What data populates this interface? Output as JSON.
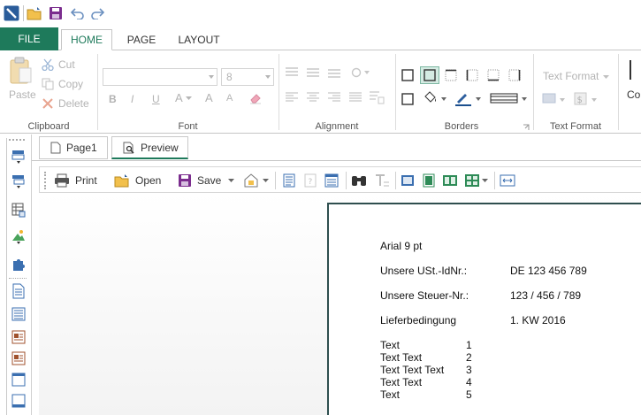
{
  "tabs": {
    "file": "FILE",
    "home": "HOME",
    "page": "PAGE",
    "layout": "LAYOUT"
  },
  "ribbon": {
    "clipboard": {
      "label": "Clipboard",
      "paste": "Paste",
      "cut": "Cut",
      "copy": "Copy",
      "delete": "Delete"
    },
    "font": {
      "label": "Font",
      "size": "8",
      "bold": "B",
      "italic": "I",
      "underline": "U",
      "font_color": "A",
      "grow": "A",
      "shrink": "A"
    },
    "alignment": {
      "label": "Alignment"
    },
    "borders": {
      "label": "Borders"
    },
    "text_format": {
      "label": "Text Format",
      "combo": "Text Format"
    },
    "co_label": "Co"
  },
  "doc_tabs": {
    "page1": "Page1",
    "preview": "Preview"
  },
  "preview_toolbar": {
    "print": "Print",
    "open": "Open",
    "save": "Save"
  },
  "page_content": {
    "font_line": "Arial 9 pt",
    "rows": [
      {
        "label": "Unsere USt.-IdNr.:",
        "value": "DE 123 456 789"
      },
      {
        "label": "Unsere Steuer-Nr.:",
        "value": "123 / 456 / 789"
      },
      {
        "label": "Lieferbedingung",
        "value": "1. KW 2016"
      }
    ],
    "list": [
      {
        "text": "Text",
        "num": "1"
      },
      {
        "text": "Text Text",
        "num": "2"
      },
      {
        "text": "Text Text Text",
        "num": "3"
      },
      {
        "text": "Text Text",
        "num": "4"
      },
      {
        "text": "Text",
        "num": "5"
      }
    ]
  },
  "colors": {
    "accent": "#1e7a5b",
    "save_purple": "#7b2d8e",
    "open_yellow": "#e0a526",
    "toolbar_blue": "#2d5f9e"
  }
}
